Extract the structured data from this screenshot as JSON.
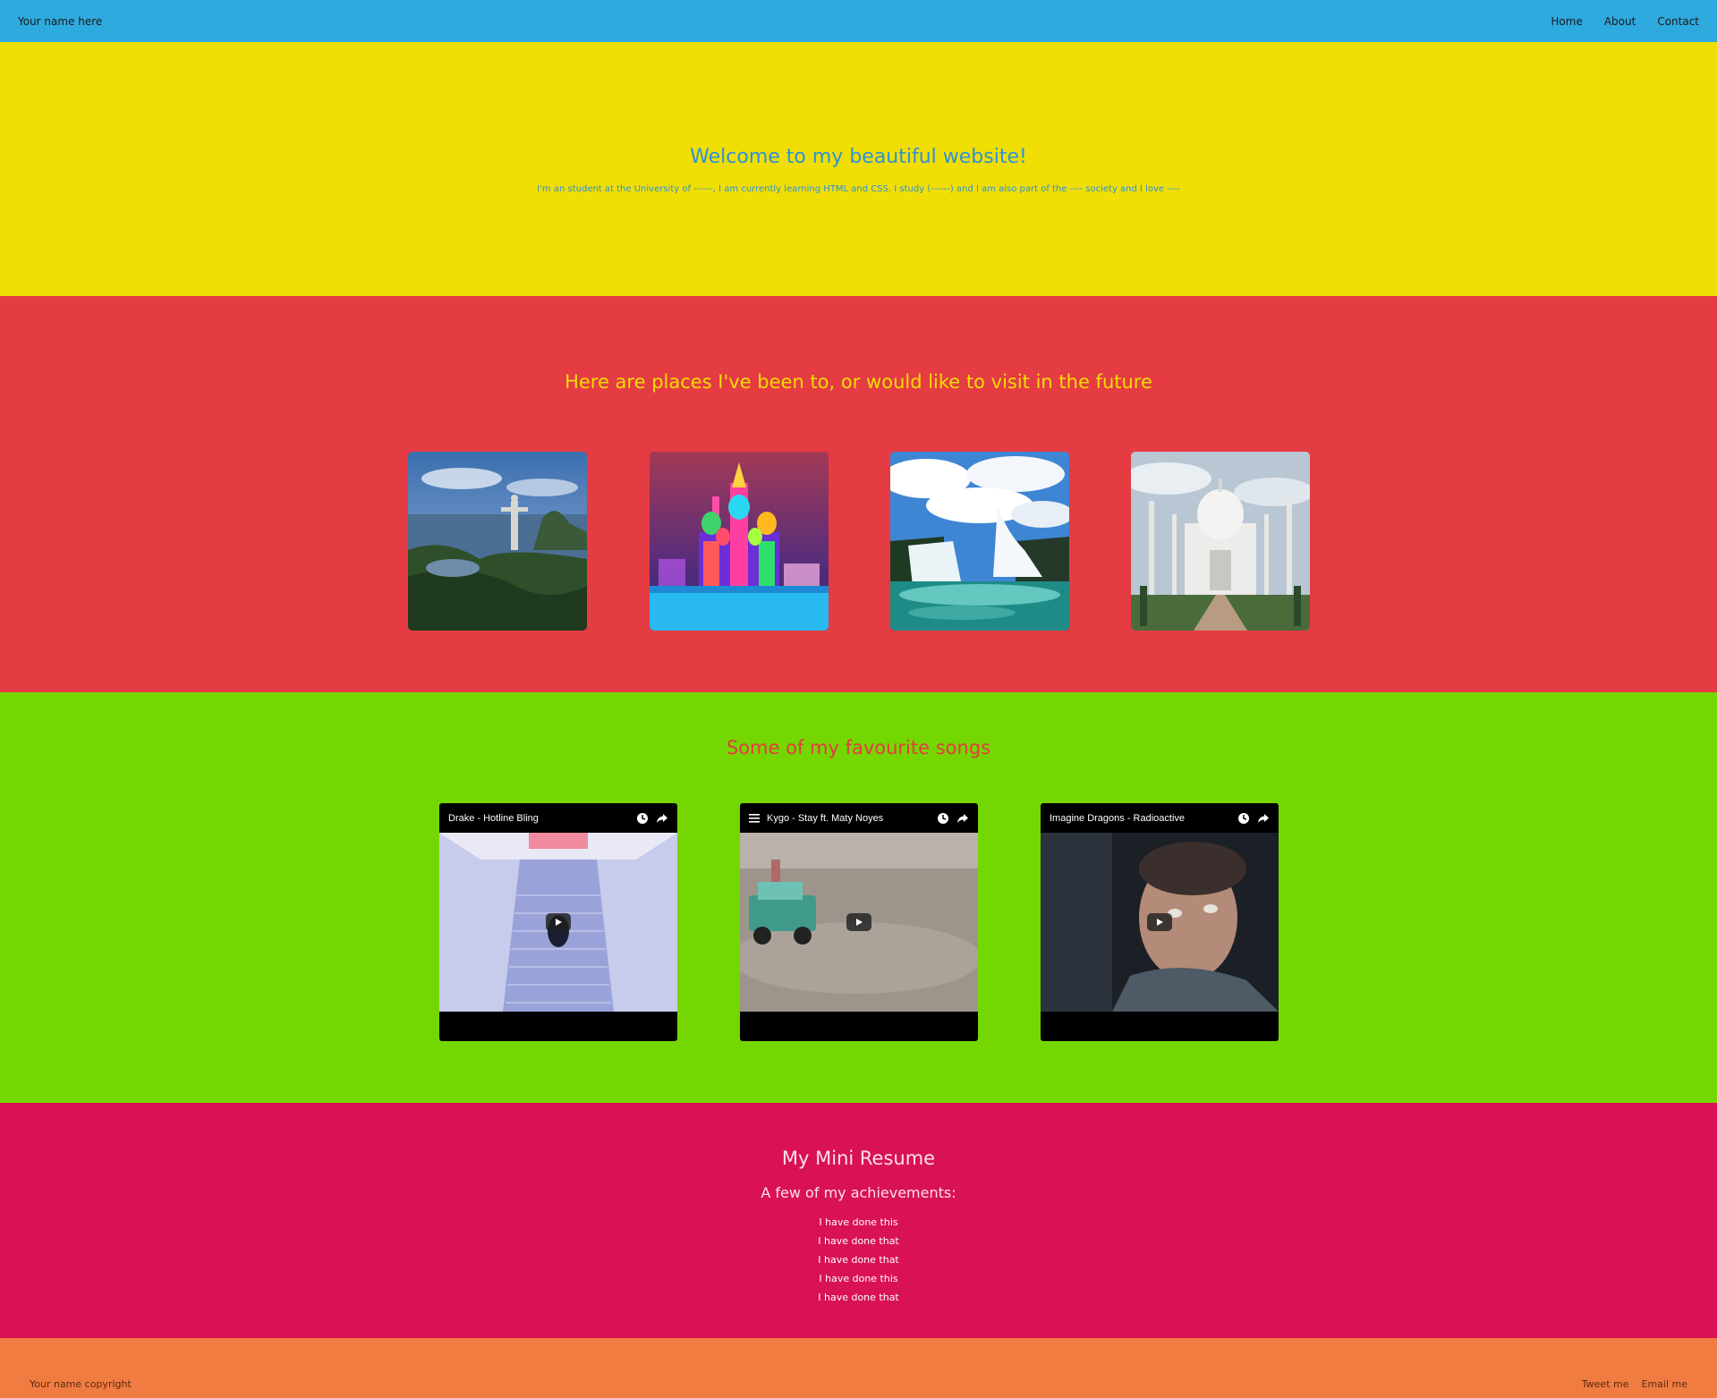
{
  "nav": {
    "brand": "Your name here",
    "links": [
      "Home",
      "About",
      "Contact"
    ]
  },
  "hero": {
    "title": "Welcome to my beautiful website!",
    "text": "I'm an student at the University of ------, I am currently learning HTML and CSS. I study (------) and I am also part of the ---- society and I love ----"
  },
  "places": {
    "title": "Here are places I've been to, or would like to visit in the future",
    "photos": [
      "christ-the-redeemer-rio",
      "st-basils-cathedral-moscow",
      "niagara-falls",
      "taj-mahal"
    ]
  },
  "songs": {
    "title": "Some of my favourite songs",
    "videos": [
      {
        "title": "Drake - Hotline Bling",
        "badge": "evo"
      },
      {
        "title": "Kygo - Stay ft. Maty Noyes",
        "badge": "evo"
      },
      {
        "title": "Imagine Dragons - Radioactive",
        "badge": "evo"
      }
    ]
  },
  "resume": {
    "title": "My Mini Resume",
    "subtitle": "A few of my achievements:",
    "items": [
      "I have done this",
      "I have done that",
      "I have done that",
      "I have done this",
      "I have done that"
    ]
  },
  "footer": {
    "copyright": "Your name copyright",
    "links": [
      "Tweet me",
      "Email me"
    ]
  },
  "colors": {
    "nav": "#2eaadf",
    "hero": "#f0de04",
    "places": "#e53b42",
    "songs": "#75d701",
    "resume": "#d91254",
    "footer": "#f07c41"
  }
}
